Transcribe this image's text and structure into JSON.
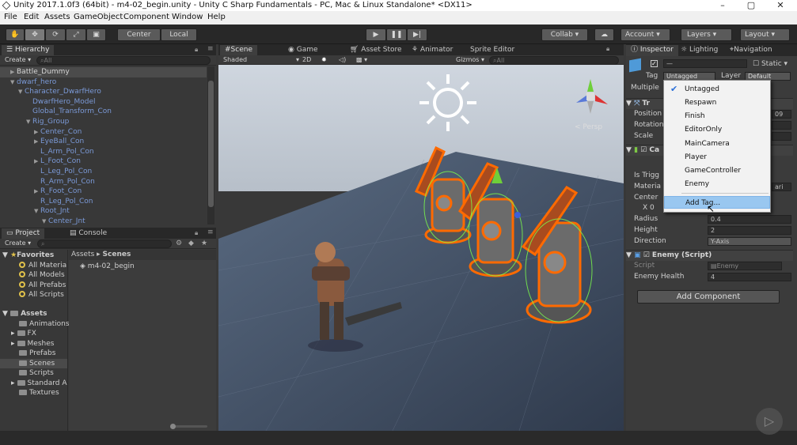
{
  "window": {
    "title": "Unity 2017.1.0f3 (64bit) - m4-02_begin.unity - Unity C Sharp Fundamentals - PC, Mac & Linux Standalone* <DX11>",
    "min": "–",
    "max": "▢",
    "close": "✕"
  },
  "menu": [
    "File",
    "Edit",
    "Assets",
    "GameObject",
    "Component",
    "Window",
    "Help"
  ],
  "toolbar": {
    "center": "Center",
    "local": "Local",
    "collab": "Collab ▾",
    "account": "Account",
    "layers": "Layers",
    "layout": "Layout"
  },
  "hierarchy": {
    "tab": "Hierarchy",
    "create": "Create ▾",
    "search_placeholder": "All",
    "items": [
      {
        "label": "Battle_Dummy",
        "indent": 0,
        "arrow": "▶",
        "white": true
      },
      {
        "label": "dwarf_hero",
        "indent": 0,
        "arrow": "▼",
        "white": false
      },
      {
        "label": "Character_DwarfHero",
        "indent": 1,
        "arrow": "▼",
        "white": false
      },
      {
        "label": "DwarfHero_Model",
        "indent": 2,
        "arrow": "",
        "white": false
      },
      {
        "label": "Global_Transform_Con",
        "indent": 2,
        "arrow": "",
        "white": false
      },
      {
        "label": "Rig_Group",
        "indent": 2,
        "arrow": "▼",
        "white": false
      },
      {
        "label": "Center_Con",
        "indent": 3,
        "arrow": "▶",
        "white": false
      },
      {
        "label": "EyeBall_Con",
        "indent": 3,
        "arrow": "▶",
        "white": false
      },
      {
        "label": "L_Arm_Pol_Con",
        "indent": 3,
        "arrow": "",
        "white": false
      },
      {
        "label": "L_Foot_Con",
        "indent": 3,
        "arrow": "▶",
        "white": false
      },
      {
        "label": "L_Leg_Pol_Con",
        "indent": 3,
        "arrow": "",
        "white": false
      },
      {
        "label": "R_Arm_Pol_Con",
        "indent": 3,
        "arrow": "",
        "white": false
      },
      {
        "label": "R_Foot_Con",
        "indent": 3,
        "arrow": "▶",
        "white": false
      },
      {
        "label": "R_Leg_Pol_Con",
        "indent": 3,
        "arrow": "",
        "white": false
      },
      {
        "label": "Root_Jnt",
        "indent": 3,
        "arrow": "▼",
        "white": false
      },
      {
        "label": "Center_Jnt",
        "indent": 4,
        "arrow": "▼",
        "white": false
      }
    ]
  },
  "project": {
    "tab": "Project",
    "console_tab": "Console",
    "create": "Create ▾",
    "favorites": {
      "label": "Favorites",
      "items": [
        "All Materia",
        "All Models",
        "All Prefabs",
        "All Scripts"
      ]
    },
    "assets": {
      "label": "Assets",
      "items": [
        "Animations",
        "FX",
        "Meshes",
        "Prefabs",
        "Scenes",
        "Scripts",
        "Standard A",
        "Textures"
      ]
    },
    "breadcrumb": [
      "Assets",
      "Scenes"
    ],
    "files": [
      "m4-02_begin"
    ]
  },
  "scene": {
    "tabs": [
      "Scene",
      "Game",
      "Asset Store",
      "Animator",
      "Sprite Editor"
    ],
    "shaded": "Shaded",
    "mode2d": "2D",
    "gizmos": "Gizmos ▾",
    "search_placeholder": "All",
    "persp": "< Persp"
  },
  "inspector": {
    "tabs": [
      "Inspector",
      "Lighting",
      "Navigation"
    ],
    "static_label": "Static ▾",
    "tag_label": "Tag",
    "tag_value": "Untagged",
    "layer_label": "Layer",
    "layer_value": "Default",
    "multiple_label": "Multiple",
    "transform": {
      "position": "Position",
      "rotation": "Rotation",
      "scale": "Scale",
      "pos_partial": "09"
    },
    "collider": {
      "is_trigger": "Is Trigg",
      "material": "Materia",
      "center": "Center",
      "x_label": "X 0",
      "radius_label": "Radius",
      "radius": "0.4",
      "height_label": "Height",
      "height": "2",
      "direction_label": "Direction",
      "direction": "Y-Axis",
      "mat_partial": "ari"
    },
    "enemy_script": {
      "title": "Enemy (Script)",
      "script_label": "Script",
      "script_value": "Enemy",
      "health_label": "Enemy Health",
      "health": "4"
    },
    "add_component": "Add Component"
  },
  "tag_dropdown": {
    "items": [
      "Untagged",
      "Respawn",
      "Finish",
      "EditorOnly",
      "MainCamera",
      "Player",
      "GameController",
      "Enemy"
    ],
    "checked": "Untagged",
    "add_tag": "Add Tag..."
  },
  "colors": {
    "selection_outline": "#ff6a00",
    "hierarchy_blue": "#7b9ad8",
    "dropdown_highlight": "#99c7f0"
  }
}
